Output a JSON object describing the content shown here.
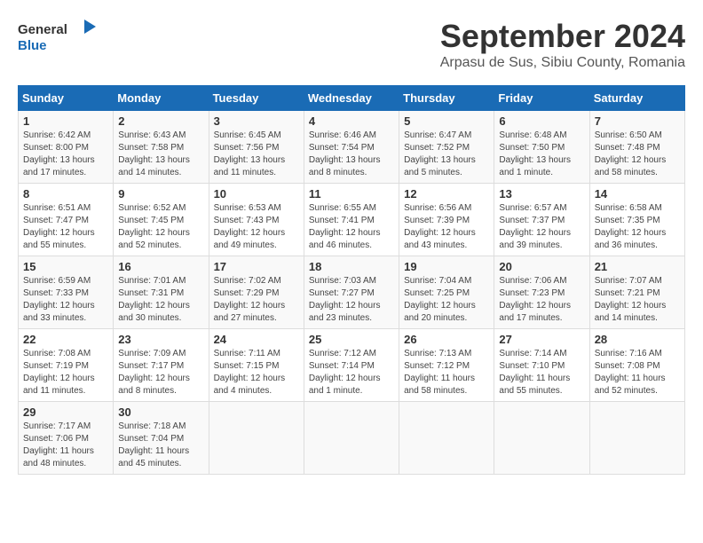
{
  "header": {
    "logo_general": "General",
    "logo_blue": "Blue",
    "title": "September 2024",
    "subtitle": "Arpasu de Sus, Sibiu County, Romania"
  },
  "calendar": {
    "days_of_week": [
      "Sunday",
      "Monday",
      "Tuesday",
      "Wednesday",
      "Thursday",
      "Friday",
      "Saturday"
    ],
    "weeks": [
      [
        null,
        null,
        null,
        null,
        null,
        null,
        null
      ]
    ],
    "cells": [
      {
        "day": 1,
        "col": 0,
        "sunrise": "6:42 AM",
        "sunset": "8:00 PM",
        "daylight": "13 hours and 17 minutes."
      },
      {
        "day": 2,
        "col": 1,
        "sunrise": "6:43 AM",
        "sunset": "7:58 PM",
        "daylight": "13 hours and 14 minutes."
      },
      {
        "day": 3,
        "col": 2,
        "sunrise": "6:45 AM",
        "sunset": "7:56 PM",
        "daylight": "13 hours and 11 minutes."
      },
      {
        "day": 4,
        "col": 3,
        "sunrise": "6:46 AM",
        "sunset": "7:54 PM",
        "daylight": "13 hours and 8 minutes."
      },
      {
        "day": 5,
        "col": 4,
        "sunrise": "6:47 AM",
        "sunset": "7:52 PM",
        "daylight": "13 hours and 5 minutes."
      },
      {
        "day": 6,
        "col": 5,
        "sunrise": "6:48 AM",
        "sunset": "7:50 PM",
        "daylight": "13 hours and 1 minute."
      },
      {
        "day": 7,
        "col": 6,
        "sunrise": "6:50 AM",
        "sunset": "7:48 PM",
        "daylight": "12 hours and 58 minutes."
      },
      {
        "day": 8,
        "col": 0,
        "sunrise": "6:51 AM",
        "sunset": "7:47 PM",
        "daylight": "12 hours and 55 minutes."
      },
      {
        "day": 9,
        "col": 1,
        "sunrise": "6:52 AM",
        "sunset": "7:45 PM",
        "daylight": "12 hours and 52 minutes."
      },
      {
        "day": 10,
        "col": 2,
        "sunrise": "6:53 AM",
        "sunset": "7:43 PM",
        "daylight": "12 hours and 49 minutes."
      },
      {
        "day": 11,
        "col": 3,
        "sunrise": "6:55 AM",
        "sunset": "7:41 PM",
        "daylight": "12 hours and 46 minutes."
      },
      {
        "day": 12,
        "col": 4,
        "sunrise": "6:56 AM",
        "sunset": "7:39 PM",
        "daylight": "12 hours and 43 minutes."
      },
      {
        "day": 13,
        "col": 5,
        "sunrise": "6:57 AM",
        "sunset": "7:37 PM",
        "daylight": "12 hours and 39 minutes."
      },
      {
        "day": 14,
        "col": 6,
        "sunrise": "6:58 AM",
        "sunset": "7:35 PM",
        "daylight": "12 hours and 36 minutes."
      },
      {
        "day": 15,
        "col": 0,
        "sunrise": "6:59 AM",
        "sunset": "7:33 PM",
        "daylight": "12 hours and 33 minutes."
      },
      {
        "day": 16,
        "col": 1,
        "sunrise": "7:01 AM",
        "sunset": "7:31 PM",
        "daylight": "12 hours and 30 minutes."
      },
      {
        "day": 17,
        "col": 2,
        "sunrise": "7:02 AM",
        "sunset": "7:29 PM",
        "daylight": "12 hours and 27 minutes."
      },
      {
        "day": 18,
        "col": 3,
        "sunrise": "7:03 AM",
        "sunset": "7:27 PM",
        "daylight": "12 hours and 23 minutes."
      },
      {
        "day": 19,
        "col": 4,
        "sunrise": "7:04 AM",
        "sunset": "7:25 PM",
        "daylight": "12 hours and 20 minutes."
      },
      {
        "day": 20,
        "col": 5,
        "sunrise": "7:06 AM",
        "sunset": "7:23 PM",
        "daylight": "12 hours and 17 minutes."
      },
      {
        "day": 21,
        "col": 6,
        "sunrise": "7:07 AM",
        "sunset": "7:21 PM",
        "daylight": "12 hours and 14 minutes."
      },
      {
        "day": 22,
        "col": 0,
        "sunrise": "7:08 AM",
        "sunset": "7:19 PM",
        "daylight": "12 hours and 11 minutes."
      },
      {
        "day": 23,
        "col": 1,
        "sunrise": "7:09 AM",
        "sunset": "7:17 PM",
        "daylight": "12 hours and 8 minutes."
      },
      {
        "day": 24,
        "col": 2,
        "sunrise": "7:11 AM",
        "sunset": "7:15 PM",
        "daylight": "12 hours and 4 minutes."
      },
      {
        "day": 25,
        "col": 3,
        "sunrise": "7:12 AM",
        "sunset": "7:14 PM",
        "daylight": "12 hours and 1 minute."
      },
      {
        "day": 26,
        "col": 4,
        "sunrise": "7:13 AM",
        "sunset": "7:12 PM",
        "daylight": "11 hours and 58 minutes."
      },
      {
        "day": 27,
        "col": 5,
        "sunrise": "7:14 AM",
        "sunset": "7:10 PM",
        "daylight": "11 hours and 55 minutes."
      },
      {
        "day": 28,
        "col": 6,
        "sunrise": "7:16 AM",
        "sunset": "7:08 PM",
        "daylight": "11 hours and 52 minutes."
      },
      {
        "day": 29,
        "col": 0,
        "sunrise": "7:17 AM",
        "sunset": "7:06 PM",
        "daylight": "11 hours and 48 minutes."
      },
      {
        "day": 30,
        "col": 1,
        "sunrise": "7:18 AM",
        "sunset": "7:04 PM",
        "daylight": "11 hours and 45 minutes."
      }
    ]
  }
}
